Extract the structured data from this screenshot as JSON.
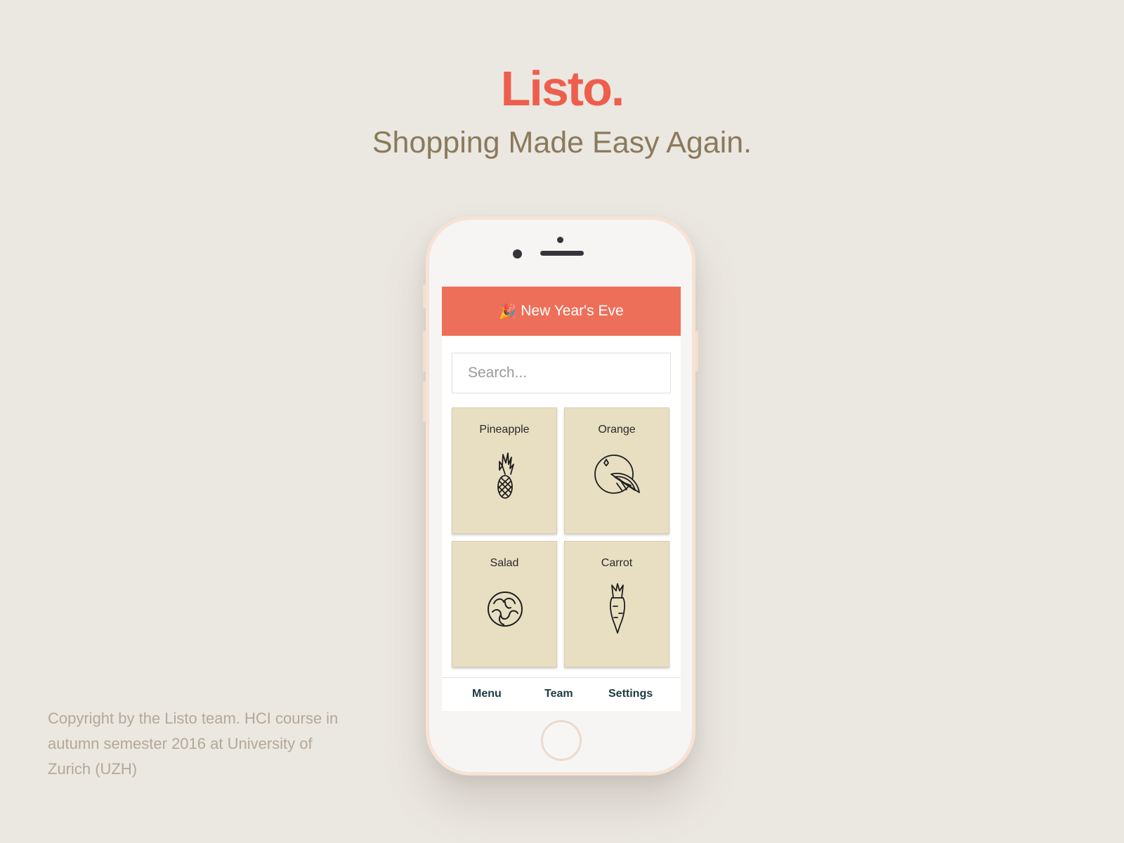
{
  "hero": {
    "brand": "Listo.",
    "tagline": "Shopping Made Easy Again."
  },
  "footer": {
    "copyright": "Copyright by the Listo team. HCI course in autumn semester 2016 at University of Zurich (UZH)"
  },
  "app": {
    "header_title": "New Year's Eve",
    "header_icon": "party-popper-icon",
    "search_placeholder": "Search...",
    "items": [
      {
        "label": "Pineapple",
        "icon": "pineapple-icon"
      },
      {
        "label": "Orange",
        "icon": "orange-icon"
      },
      {
        "label": "Salad",
        "icon": "salad-icon"
      },
      {
        "label": "Carrot",
        "icon": "carrot-icon"
      }
    ],
    "nav": {
      "menu": "Menu",
      "team": "Team",
      "settings": "Settings"
    }
  },
  "colors": {
    "background": "#ebe7e1",
    "brand": "#ee5e4c",
    "header": "#ee6f59",
    "tile": "#e8dec2",
    "tagline": "#8a7a5c"
  }
}
